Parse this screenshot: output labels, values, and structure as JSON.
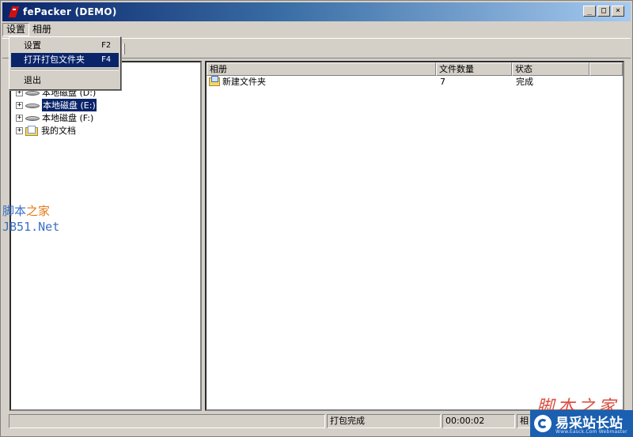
{
  "window": {
    "title": "fePacker (DEMO)",
    "minimize": "_",
    "maximize": "□",
    "close": "×"
  },
  "menubar": {
    "settings": "设置",
    "album": "相册"
  },
  "dropdown": {
    "items": [
      {
        "label": "设置",
        "shortcut": "F2"
      },
      {
        "label": "打开打包文件夹",
        "shortcut": "F4"
      },
      {
        "label": "退出",
        "shortcut": ""
      }
    ]
  },
  "tree": {
    "items": [
      {
        "label": "本地磁盘 (D:)",
        "icon": "drive-icon",
        "expander": "+"
      },
      {
        "label": "本地磁盘 (E:)",
        "icon": "drive-icon",
        "expander": "+"
      },
      {
        "label": "本地磁盘 (F:)",
        "icon": "drive-icon",
        "expander": "+"
      },
      {
        "label": "我的文档",
        "icon": "folder-icon",
        "expander": "+"
      }
    ]
  },
  "list": {
    "columns": [
      "相册",
      "文件数量",
      "状态"
    ],
    "rows": [
      {
        "album": "新建文件夹",
        "count": "7",
        "status": "完成"
      }
    ]
  },
  "statusbar": {
    "message": "打包完成",
    "time": "00:00:02",
    "extra": "相"
  },
  "watermarks": {
    "left_a": "脚本",
    "left_b": "之家",
    "left_line2": "JB51.Net",
    "bottom_right": "脚本之家",
    "brand": "易采站长站",
    "brand_sub": "Www.Easck.Com Webmaster"
  },
  "colors": {
    "selection": "#0a246a",
    "title_gradient_start": "#0a246a",
    "title_gradient_end": "#a6caf0",
    "face": "#d4d0c8"
  }
}
